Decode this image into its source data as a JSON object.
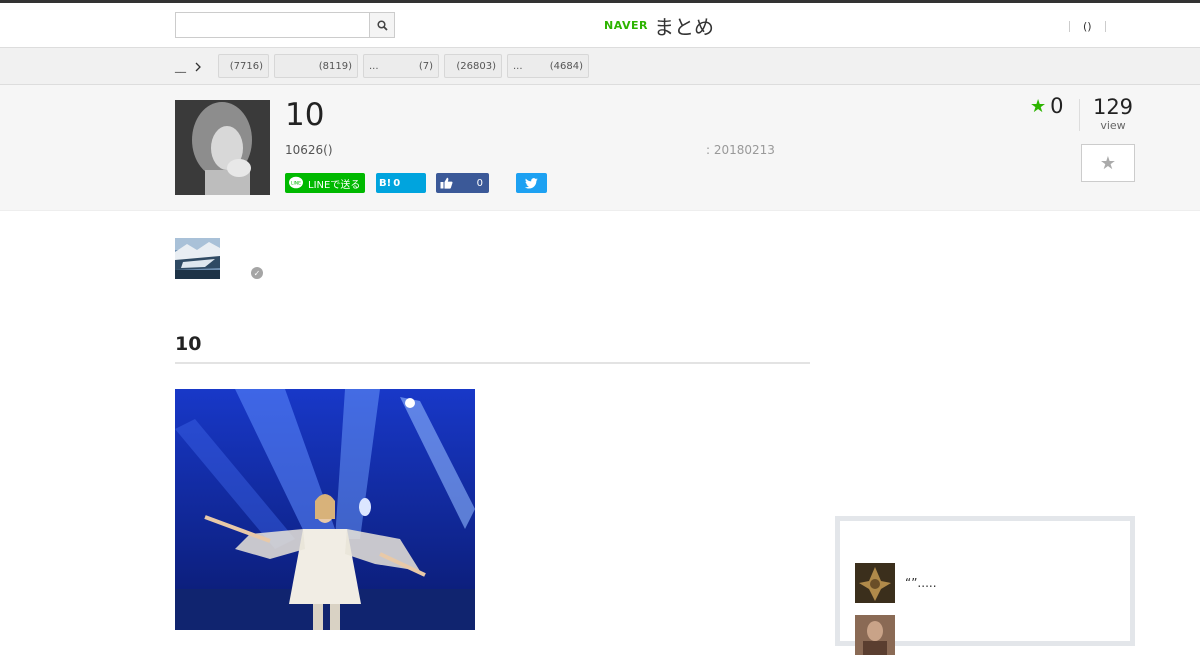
{
  "header": {
    "search_placeholder": "",
    "logo_brand": "NAVER",
    "logo_service": "まとめ",
    "right_link": "()"
  },
  "category_bar": {
    "first": "__",
    "tags": [
      {
        "name": "",
        "count": "(7716)"
      },
      {
        "name": "",
        "count": "(8119)"
      },
      {
        "name": "...",
        "count": "(7)"
      },
      {
        "name": "",
        "count": "(26803)"
      },
      {
        "name": "...",
        "count": "(4684)"
      }
    ]
  },
  "article": {
    "title": "10",
    "count_text": "10626()",
    "date_text": ": 20180213",
    "favorites": "0",
    "views": "129",
    "views_label": "view"
  },
  "share": {
    "line_label": "LINEで送る",
    "hatena_label": "B!",
    "hatena_count": "0",
    "facebook_count": "0"
  },
  "section": {
    "title": "10"
  },
  "sidebar": {
    "items": [
      {
        "text": "“”....."
      },
      {
        "text": ""
      }
    ]
  },
  "colors": {
    "naver_green": "#2db400",
    "line_green": "#00b900",
    "hatena_blue": "#00a4de",
    "facebook_blue": "#3b5998",
    "twitter_blue": "#1da1f2"
  },
  "icons": [
    "search-icon",
    "chevron-right-icon",
    "star-icon",
    "line-icon",
    "thumbs-up-icon",
    "twitter-icon",
    "verified-check-icon"
  ]
}
